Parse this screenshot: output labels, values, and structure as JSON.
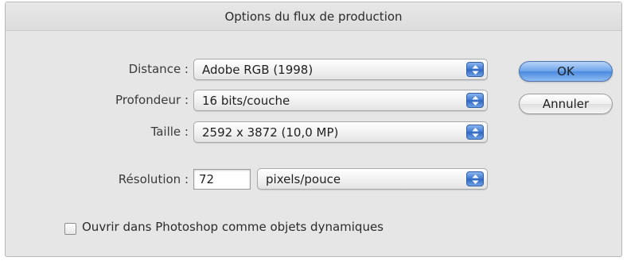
{
  "dialog": {
    "title": "Options du flux de production"
  },
  "fields": {
    "distance": {
      "label": "Distance :",
      "value": "Adobe RGB (1998)"
    },
    "profondeur": {
      "label": "Profondeur :",
      "value": "16 bits/couche"
    },
    "taille": {
      "label": "Taille :",
      "value": "2592 x 3872 (10,0 MP)"
    },
    "resolution": {
      "label": "Résolution :",
      "value": "72",
      "unit": "pixels/pouce"
    }
  },
  "buttons": {
    "ok": "OK",
    "cancel": "Annuler"
  },
  "options": {
    "smart_objects_label": "Ouvrir dans Photoshop comme objets dynamiques",
    "smart_objects_checked": false
  },
  "colors": {
    "accent": "#4b8ae0",
    "dialog_bg": "#e6e6e6"
  }
}
